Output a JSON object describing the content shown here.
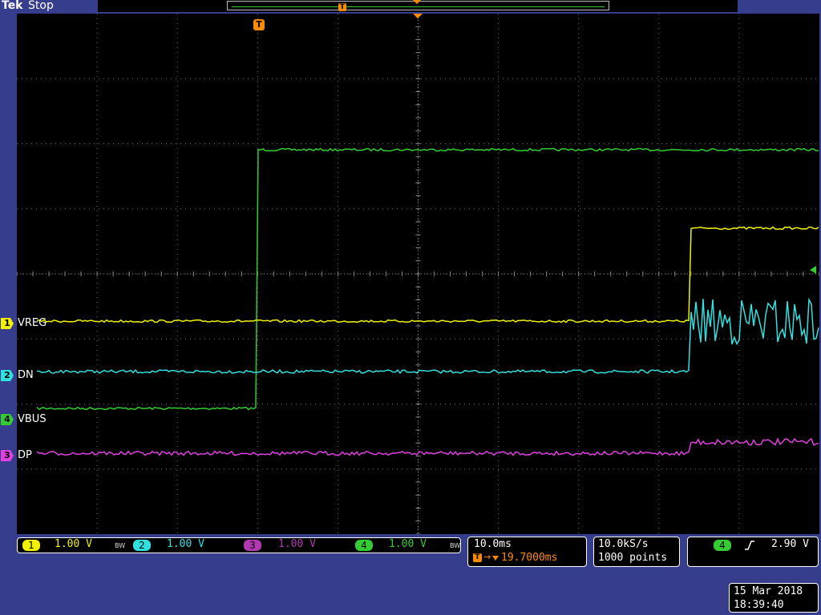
{
  "header": {
    "brand": "Tek",
    "run_state": "Stop"
  },
  "colors": {
    "ch1": "#f2f200",
    "ch2": "#33e0e0",
    "ch3": "#e040e0",
    "ch4": "#33cc33",
    "trigger": "#ff8c00",
    "frame": "#363d8c"
  },
  "channels": [
    {
      "number": "1",
      "name": "VREG",
      "scale": "1.00 V",
      "bw_limit": "BW"
    },
    {
      "number": "2",
      "name": "DN",
      "scale": "1.00 V"
    },
    {
      "number": "3",
      "name": "DP",
      "scale": "1.00 V"
    },
    {
      "number": "4",
      "name": "VBUS",
      "scale": "1.00 V",
      "bw_limit": "BW"
    }
  ],
  "timebase": {
    "scale": "10.0ms",
    "trigger_position": "19.7000ms"
  },
  "acquisition": {
    "sample_rate": "10.0kS/s",
    "record_length": "1000 points"
  },
  "trigger": {
    "source": "4",
    "slope_icon": "rising-edge-icon",
    "level": "2.90 V",
    "marker_label": "T"
  },
  "datetime": {
    "date": "15 Mar 2018",
    "time": "18:39:40"
  }
}
